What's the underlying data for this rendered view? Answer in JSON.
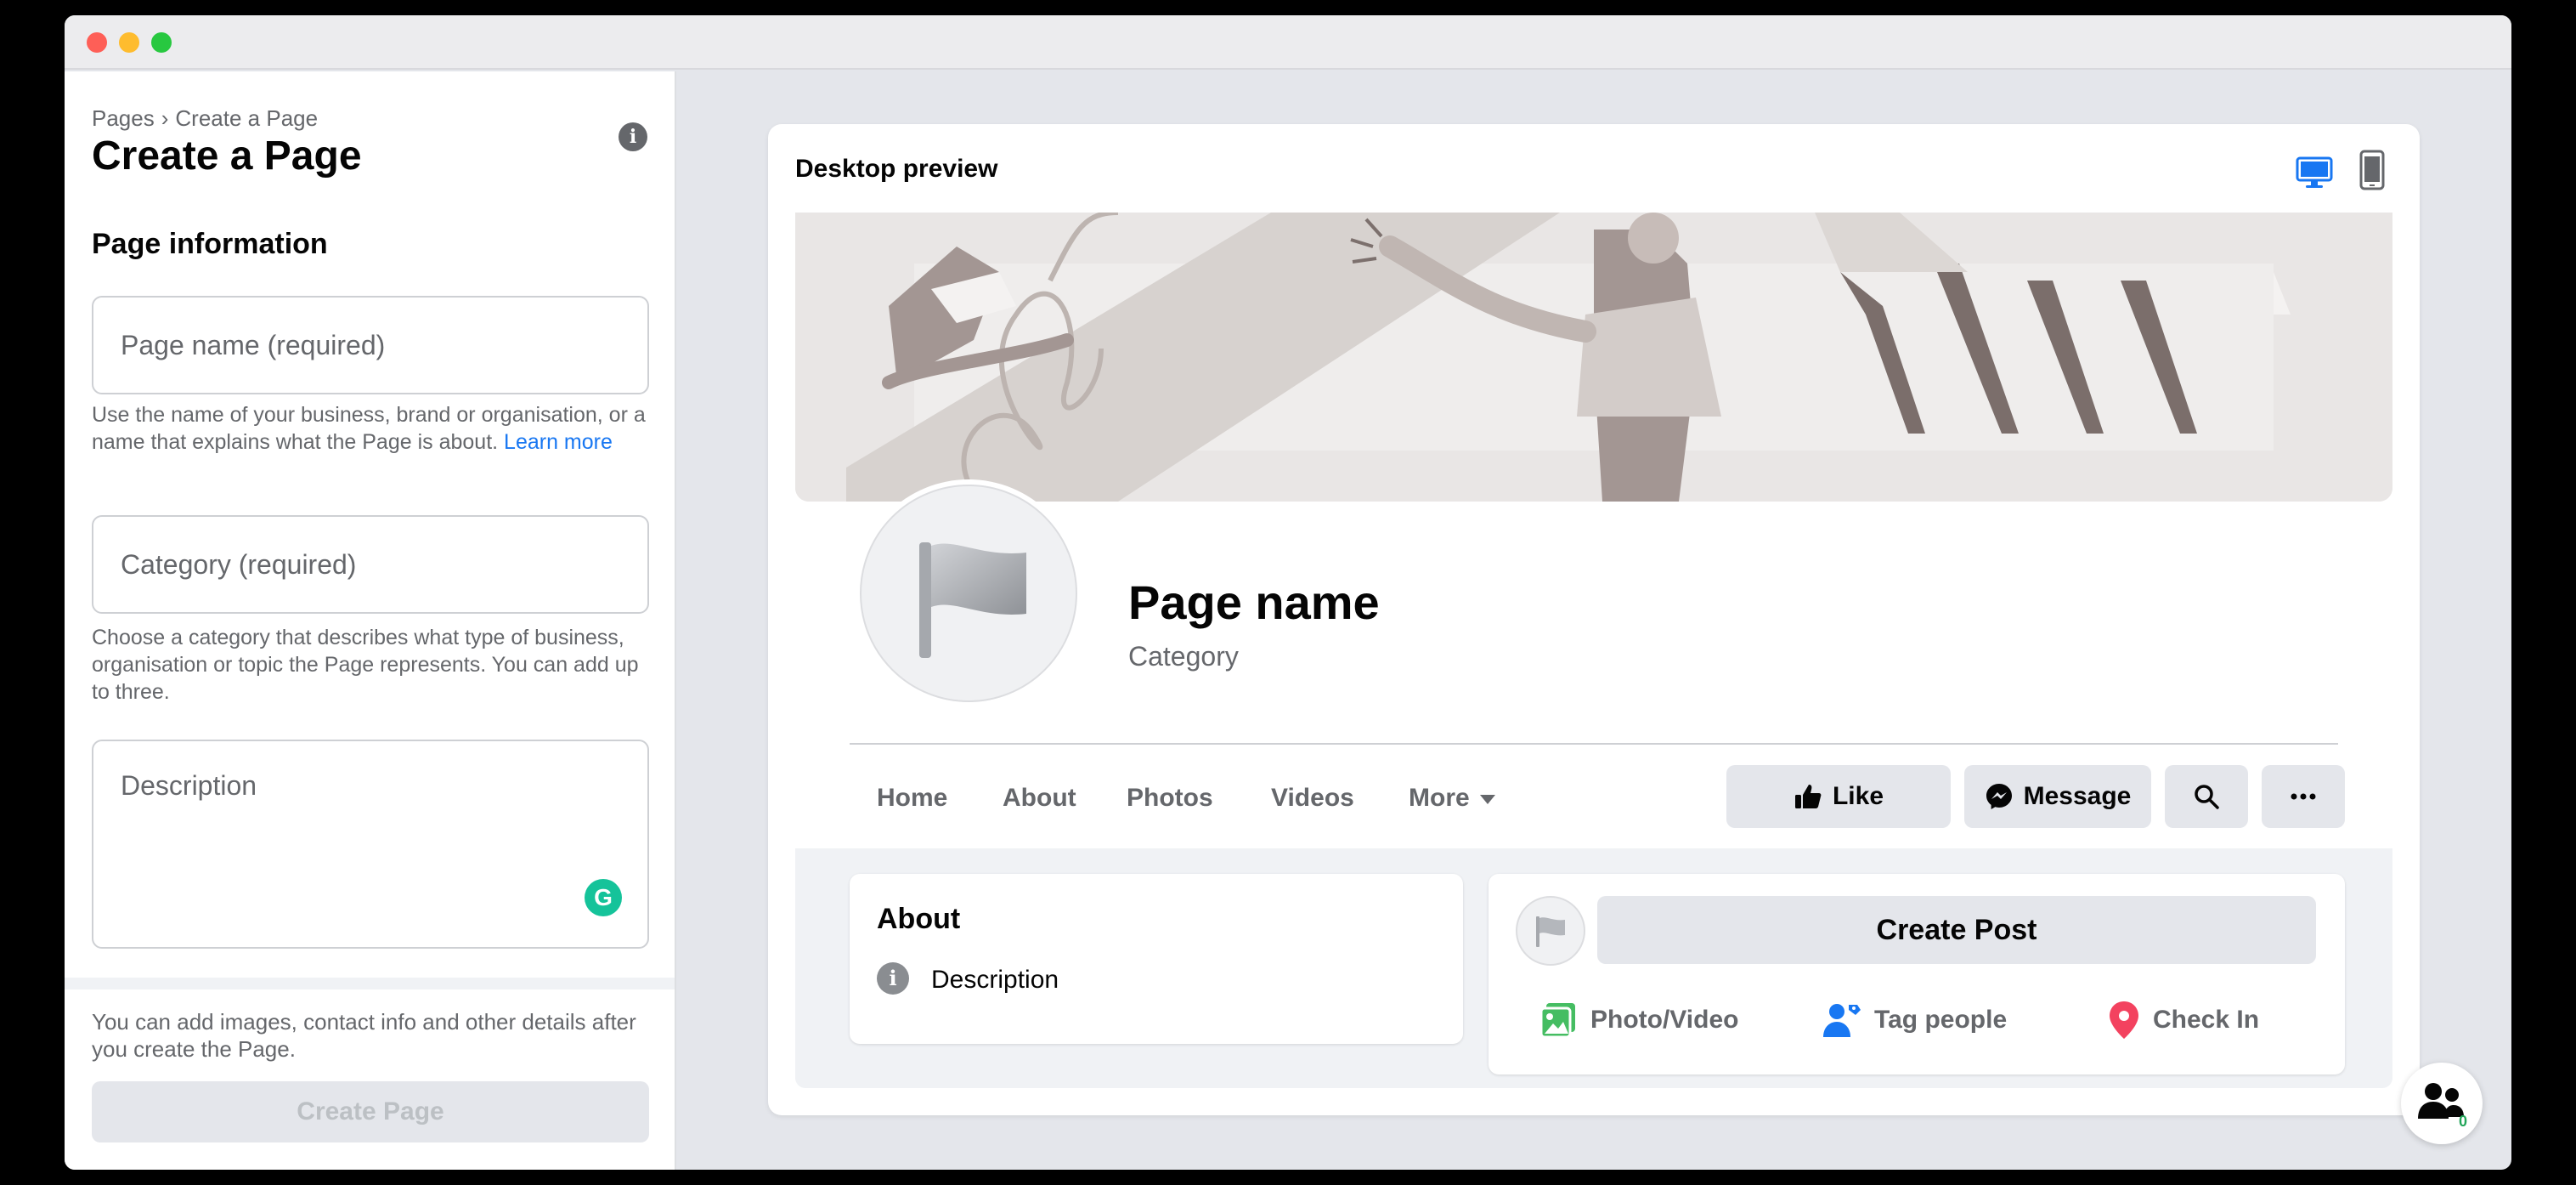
{
  "window": {
    "traffic_lights": [
      "close",
      "minimize",
      "zoom"
    ]
  },
  "left_panel": {
    "breadcrumb": {
      "parent": "Pages",
      "separator": "›",
      "current": "Create a Page"
    },
    "title": "Create a Page",
    "section_title": "Page information",
    "page_name_field": {
      "placeholder": "Page name (required)",
      "value": ""
    },
    "page_name_help": "Use the name of your business, brand or organisation, or a name that explains what the Page is about.",
    "learn_more": "Learn more",
    "category_field": {
      "placeholder": "Category (required)",
      "value": ""
    },
    "category_help": "Choose a category that describes what type of business, organisation or topic the Page represents. You can add up to three.",
    "description_field": {
      "placeholder": "Description",
      "value": ""
    },
    "footer_note": "You can add images, contact info and other details after you create the Page.",
    "create_button": "Create Page"
  },
  "preview": {
    "title": "Desktop preview",
    "active_device": "desktop",
    "page_name": "Page name",
    "category": "Category",
    "tabs": [
      "Home",
      "About",
      "Photos",
      "Videos",
      "More"
    ],
    "buttons": {
      "like": "Like",
      "message": "Message"
    },
    "about": {
      "title": "About",
      "description": "Description"
    },
    "composer": {
      "create_post": "Create Post",
      "actions": [
        "Photo/Video",
        "Tag people",
        "Check In"
      ]
    }
  },
  "floating_button": {
    "icon": "people-icon",
    "count": "0"
  },
  "colors": {
    "accent": "#1877f2",
    "grammarly": "#15c39a",
    "photo_green": "#45bd62",
    "tag_blue": "#1877f2",
    "checkin_red": "#f3425f"
  }
}
